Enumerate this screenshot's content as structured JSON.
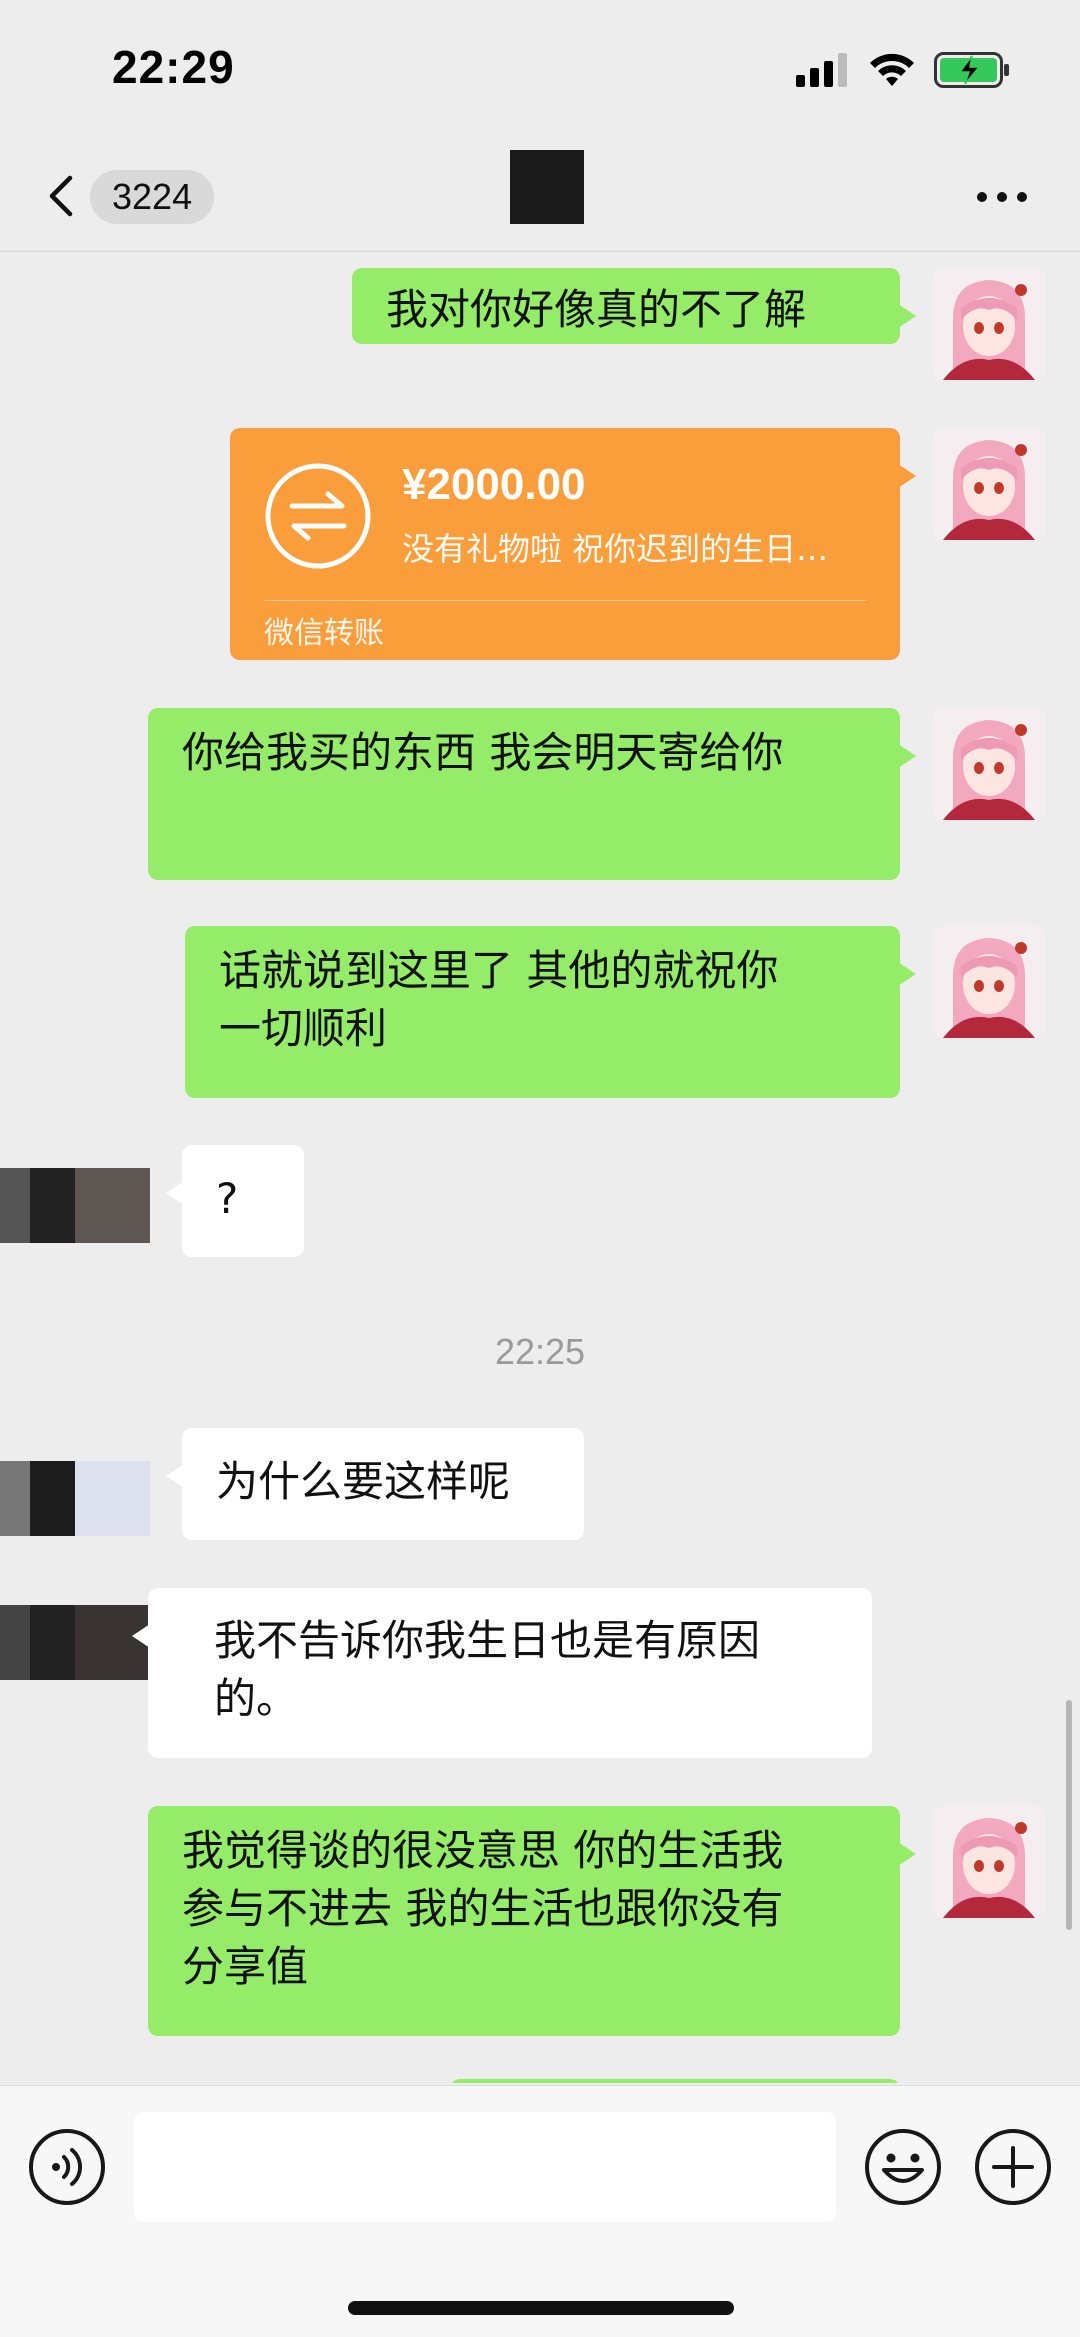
{
  "status_bar": {
    "time": "22:29"
  },
  "nav": {
    "unread_count": "3224",
    "back_icon": "chevron-left-icon",
    "more_icon": "ellipsis-icon"
  },
  "messages": [
    {
      "side": "me",
      "type": "text",
      "text": "我对你好像真的不了解"
    },
    {
      "side": "me",
      "type": "transfer",
      "amount": "¥2000.00",
      "note": "没有礼物啦 祝你迟到的生日…",
      "label": "微信转账"
    },
    {
      "side": "me",
      "type": "text",
      "text": "你给我买的东西 我会明天寄给你"
    },
    {
      "side": "me",
      "type": "text",
      "line1": "话就说到这里了  其他的就祝你",
      "line2": "一切顺利"
    },
    {
      "side": "them",
      "type": "text",
      "text": "?"
    },
    {
      "type": "timestamp",
      "text": "22:25"
    },
    {
      "side": "them",
      "type": "text",
      "text": "为什么要这样呢"
    },
    {
      "side": "them",
      "type": "text",
      "line1": "我不告诉你我生日也是有原因",
      "line2": "的。"
    },
    {
      "side": "me",
      "type": "text",
      "line1": "我觉得谈的很没意思 你的生活我",
      "line2": "参与不进去 我的生活也跟你没有",
      "line3": "分享值"
    }
  ],
  "input_bar": {
    "value": "",
    "voice_icon": "voice-icon",
    "emoji_icon": "emoji-icon",
    "plus_icon": "plus-icon"
  },
  "colors": {
    "my_bubble": "#95ec69",
    "their_bubble": "#ffffff",
    "transfer": "#fa9d3b",
    "background": "#ededed"
  }
}
